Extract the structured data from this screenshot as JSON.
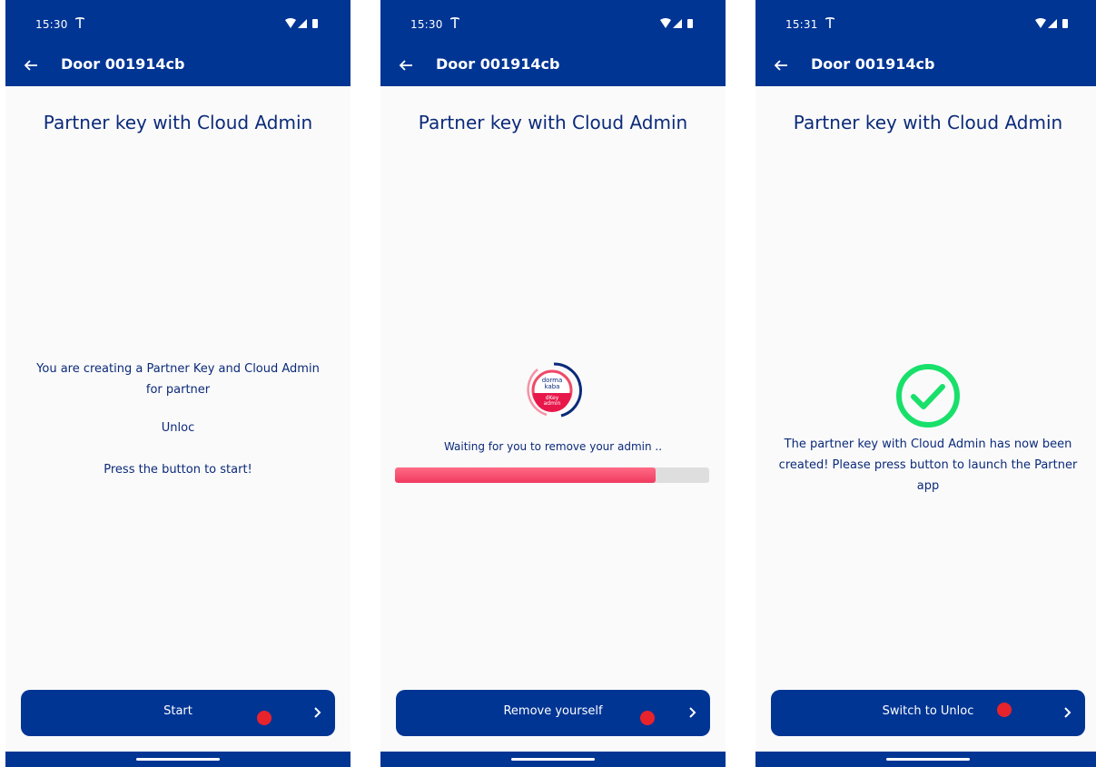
{
  "colors": {
    "primary": "#003594",
    "accent_red": "#e8232c",
    "progress": "#f03a5f",
    "success": "#18e06a",
    "text": "#0b2a7a"
  },
  "screens": [
    {
      "status": {
        "time": "15:30"
      },
      "appbar": {
        "back_icon": "arrow-left-icon",
        "title": "Door 001914cb"
      },
      "page_title": "Partner key with Cloud Admin",
      "message_line1": "You are creating a Partner Key and Cloud Admin for partner",
      "message_line2": "Unloc",
      "message_line3": "Press the button to start!",
      "button": {
        "label": "Start",
        "icon": "chevron-right-icon"
      }
    },
    {
      "status": {
        "time": "15:30"
      },
      "appbar": {
        "back_icon": "arrow-left-icon",
        "title": "Door 001914cb"
      },
      "page_title": "Partner key with Cloud Admin",
      "logo": {
        "line1": "dorma",
        "line2": "kaba",
        "line3": "dKey",
        "line4": "admin"
      },
      "waiting_text": "Waiting for you to remove your admin ..",
      "progress": 0.83,
      "button": {
        "label": "Remove yourself",
        "icon": "chevron-right-icon"
      }
    },
    {
      "status": {
        "time": "15:31"
      },
      "appbar": {
        "back_icon": "arrow-left-icon",
        "title": "Door 001914cb"
      },
      "page_title": "Partner key with Cloud Admin",
      "success_icon": "check-circle-icon",
      "success_message": "The partner key with Cloud Admin has now been created! Please press button to launch the Partner app",
      "button": {
        "label": "Switch to Unloc",
        "icon": "chevron-right-icon"
      }
    }
  ]
}
